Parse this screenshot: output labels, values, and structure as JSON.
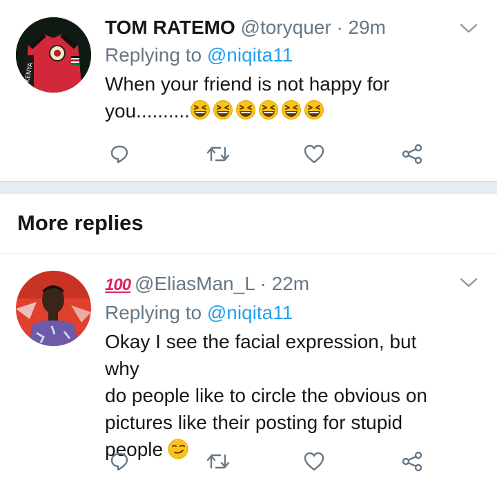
{
  "tweets": [
    {
      "display_name": "TOM RATEMO",
      "handle": "@toryquer",
      "time": "· 29m",
      "replying_prefix": "Replying to",
      "replying_to": "@niqita11",
      "text_line1": "When your friend is not happy for",
      "text_line2": "you..........",
      "trailing_emoji": [
        "grinning-squinting-face",
        "grinning-squinting-face",
        "grinning-squinting-face",
        "grinning-squinting-face",
        "grinning-squinting-face",
        "grinning-squinting-face"
      ],
      "avatar": "avatar-kenya-jersey"
    },
    {
      "prefix_emoji": "💯",
      "handle": "@EliasMan_L",
      "time": "· 22m",
      "replying_prefix": "Replying to",
      "replying_to": "@niqita11",
      "text_lines": [
        "Okay I see the facial expression, but why",
        "do people like to circle the obvious on",
        "pictures like their posting for stupid",
        "people"
      ],
      "trailing_emoji": "smirking-face",
      "avatar": "avatar-man-red-background"
    }
  ],
  "section": {
    "title": "More replies"
  },
  "actions": [
    "reply-icon",
    "retweet-icon",
    "like-icon",
    "share-icon"
  ],
  "colors": {
    "link": "#1da1f2",
    "secondary_text": "#657786",
    "primary_text": "#14171a",
    "separator": "#e6ecf0"
  }
}
